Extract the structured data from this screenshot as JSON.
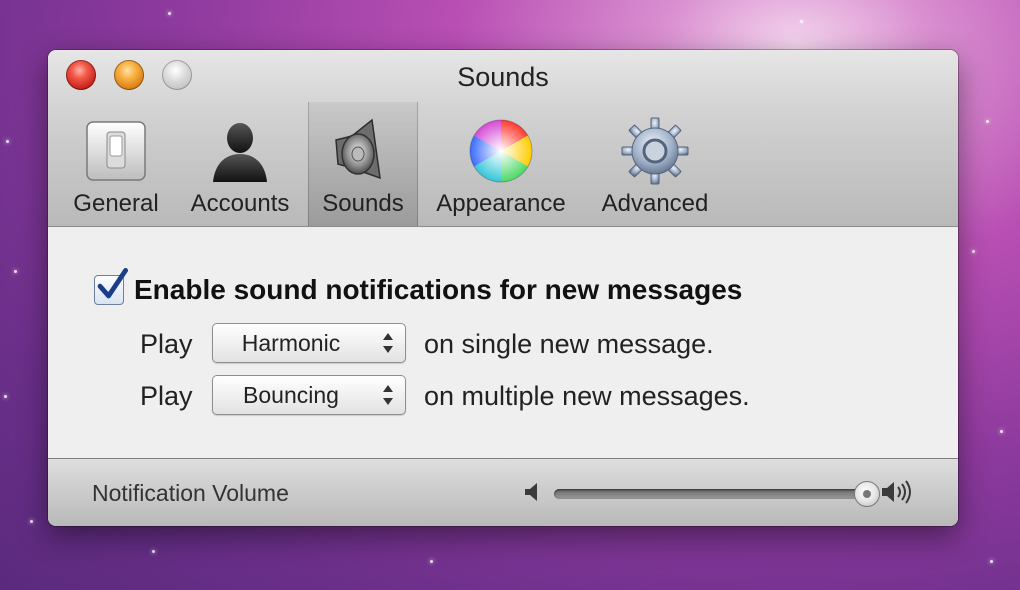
{
  "window": {
    "title": "Sounds"
  },
  "toolbar": {
    "items": [
      {
        "label": "General",
        "icon": "switch-icon"
      },
      {
        "label": "Accounts",
        "icon": "person-silhouette-icon"
      },
      {
        "label": "Sounds",
        "icon": "speaker-icon",
        "selected": true
      },
      {
        "label": "Appearance",
        "icon": "color-wheel-icon"
      },
      {
        "label": "Advanced",
        "icon": "gear-icon"
      }
    ]
  },
  "content": {
    "enable_label": "Enable sound notifications for new messages",
    "enable_checked": true,
    "single": {
      "prefix": "Play",
      "selected": "Harmonic",
      "suffix": "on single new message."
    },
    "multiple": {
      "prefix": "Play",
      "selected": "Bouncing",
      "suffix": "on multiple new messages."
    }
  },
  "volume": {
    "label": "Notification Volume",
    "level": 1.0
  },
  "colors": {
    "accent": "#2f6bd6",
    "traffic_close": "#e0473a",
    "traffic_minimize": "#f0a030",
    "traffic_zoom": "#c8c8c8"
  }
}
